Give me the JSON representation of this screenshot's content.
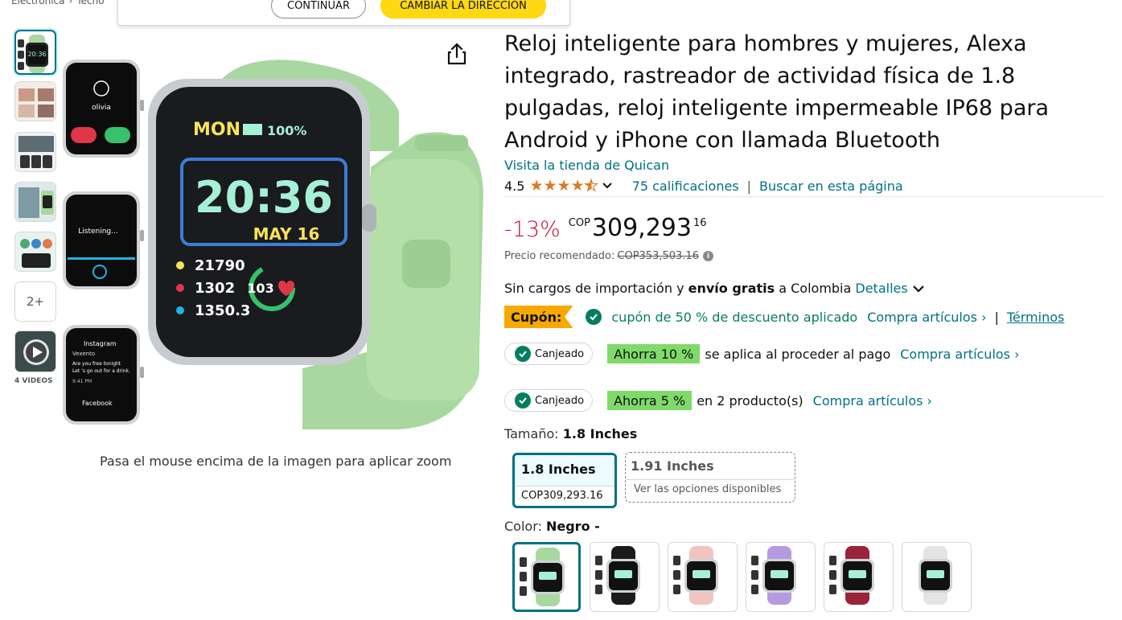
{
  "breadcrumb": [
    "Electrónica",
    "Tecno"
  ],
  "popover": {
    "continue_label": "CONTINUAR",
    "change_label": "CAMBIAR LA DIRECCIÓN"
  },
  "gallery": {
    "more_label": "2+",
    "videos_label": "4 VIDEOS",
    "zoom_hint": "Pasa el mouse encima de la imagen para aplicar zoom",
    "watch_screen": {
      "day": "MON",
      "battery": "100%",
      "time": "20:36",
      "date": "MAY 16",
      "steps": "21790",
      "calories": "1302",
      "distance": "1350.3",
      "heart_rate": "103"
    },
    "side_screens": {
      "caller": "olivia",
      "listening": "Listening...",
      "app": "Instagram",
      "contact": "Vexento",
      "msg1": "Are you free tonight",
      "msg2": "Let 's go out for a drink.",
      "msg_time": "9:41 PM",
      "app2": "Facebook"
    }
  },
  "product": {
    "title": "Reloj inteligente para hombres y mujeres, Alexa integrado, rastreador de actividad física de 1.8 pulgadas, reloj inteligente impermeable IP68 para Android y iPhone con llamada Bluetooth",
    "store_link": "Visita la tienda de Quican",
    "rating": "4.5",
    "ratings_count": "75 calificaciones",
    "search_page": "Buscar en esta página",
    "discount": "-13%",
    "currency": "COP",
    "price_whole": "309,293",
    "price_fraction": "16",
    "list_price_label": "Precio recomendado:",
    "list_price": "COP353,503.16",
    "shipping_pre": "Sin cargos de importación y ",
    "shipping_bold": "envío gratis",
    "shipping_post": " a Colombia ",
    "shipping_details": "Detalles",
    "coupon_badge": "Cupón:",
    "coupon_text": "cupón de 50 % de descuento aplicado",
    "coupon_shop": "Compra artículos ›",
    "coupon_sep": "|",
    "coupon_terms": "Términos",
    "promos": [
      {
        "redeemed": "Canjeado",
        "save": "Ahorra 10 %",
        "text": "se aplica al proceder al pago",
        "shop": "Compra artículos ›"
      },
      {
        "redeemed": "Canjeado",
        "save": "Ahorra 5 %",
        "text": "en 2 producto(s)",
        "shop": "Compra artículos ›"
      }
    ],
    "size_label": "Tamaño:",
    "size_value": "1.8 Inches",
    "sizes": [
      {
        "name": "1.8 Inches",
        "price": "COP309,293.16"
      },
      {
        "name": "1.91 Inches",
        "price": "Ver las opciones disponibles"
      }
    ],
    "color_label": "Color:",
    "color_value": "Negro -",
    "colors": [
      "#a8d8a0",
      "#1b1b1b",
      "#f2c4c0",
      "#b59ae0",
      "#9a2438",
      "#e4e4e4"
    ],
    "accent": "#007185"
  }
}
